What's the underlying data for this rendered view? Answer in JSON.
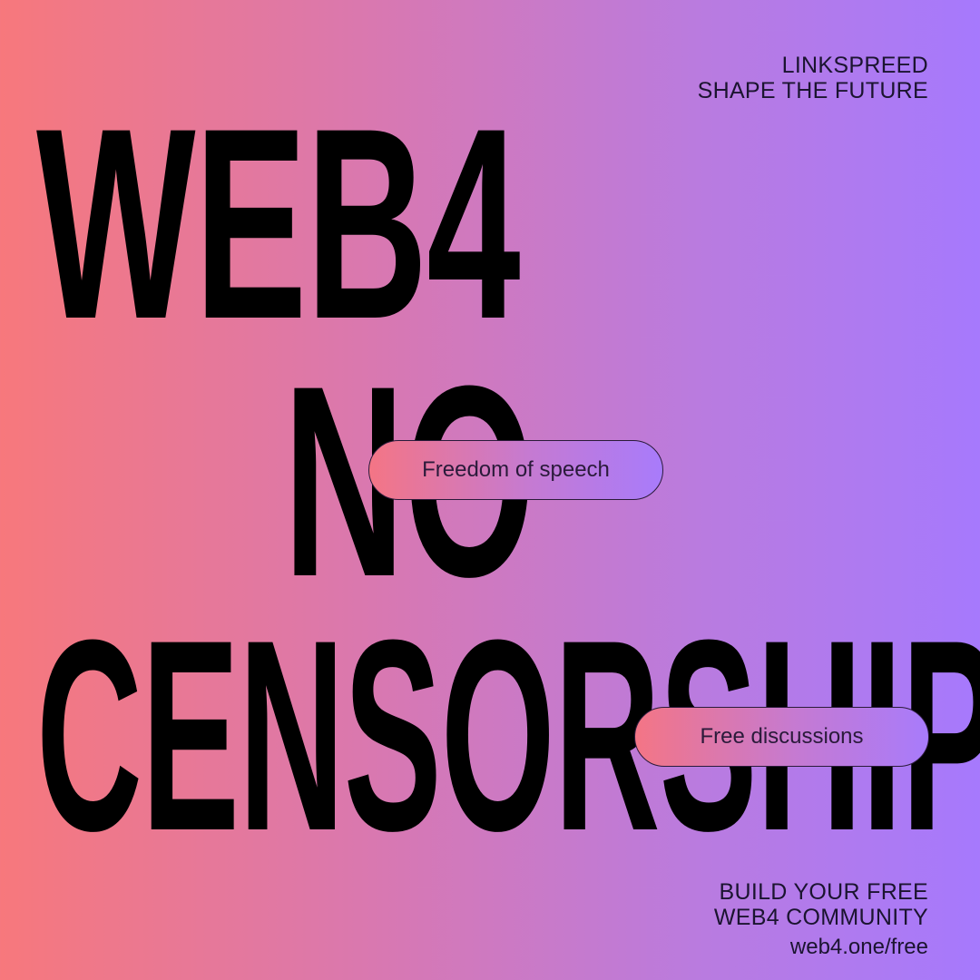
{
  "headline": {
    "line1": "WEB4",
    "line2": "NO",
    "line3": "CENSORSHIP"
  },
  "brand": {
    "name": "LINKSPREED",
    "slogan": "SHAPE THE FUTURE"
  },
  "pills": [
    {
      "label": "Freedom of speech"
    },
    {
      "label": "Free discussions"
    }
  ],
  "cta": {
    "line1": "BUILD YOUR FREE",
    "line2": "WEB4 COMMUNITY",
    "url": "web4.one/free"
  },
  "colors": {
    "gradient_start": "#f7787c",
    "gradient_end": "#a679fd",
    "text": "#000000"
  }
}
